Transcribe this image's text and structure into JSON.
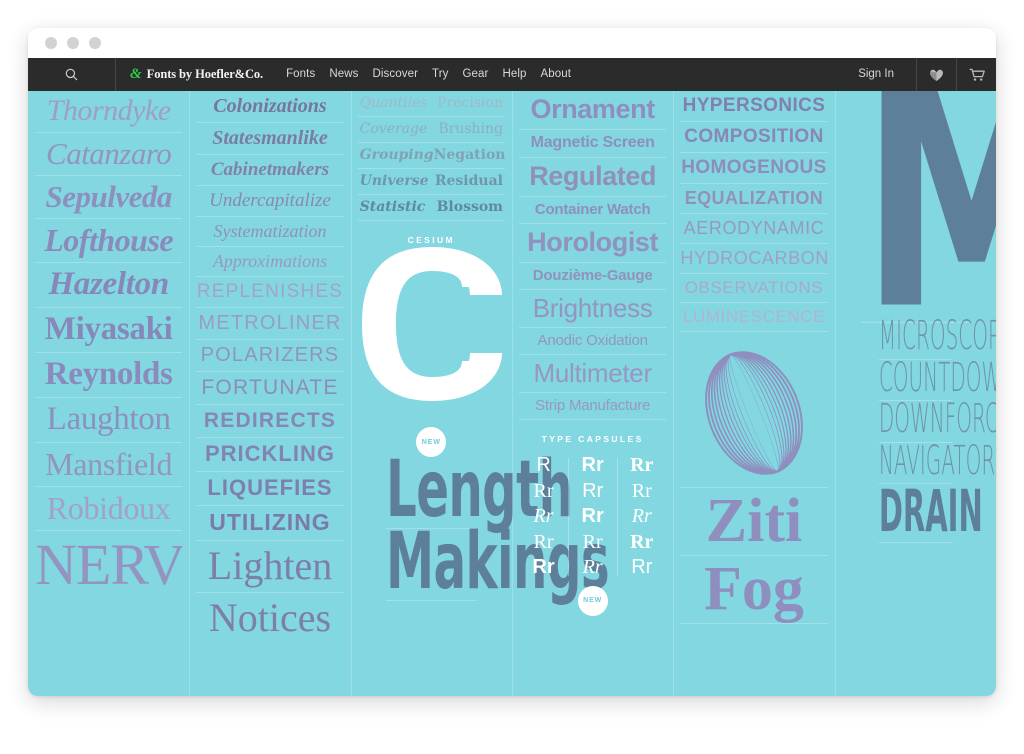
{
  "window": {
    "traffic_lights": [
      "close",
      "minimize",
      "zoom"
    ]
  },
  "nav": {
    "search_icon": "search-icon",
    "brand_ampersand": "&",
    "brand_name": "Fonts by Hoefler&Co.",
    "links": [
      "Fonts",
      "News",
      "Discover",
      "Try",
      "Gear",
      "Help",
      "About"
    ],
    "sign_in": "Sign In",
    "favorites_icon": "heart-icon",
    "cart_icon": "shopping-cart-icon"
  },
  "columns": {
    "col1": {
      "items": [
        {
          "text": "Thorndyke",
          "size": 30,
          "weight": 400,
          "style": "italic",
          "color": "#9f9fc4",
          "tracking": -0.5
        },
        {
          "text": "Catanzaro",
          "size": 31,
          "weight": 400,
          "style": "italic",
          "color": "#9494c0",
          "tracking": -0.5
        },
        {
          "text": "Sepulveda",
          "size": 31,
          "weight": 600,
          "style": "italic",
          "color": "#8e8fbe",
          "tracking": -0.5
        },
        {
          "text": "Lofthouse",
          "size": 32,
          "weight": 700,
          "style": "italic",
          "color": "#8a8bbc",
          "tracking": -0.5
        },
        {
          "text": "Hazelton",
          "size": 33,
          "weight": 700,
          "style": "italic",
          "color": "#8688ba",
          "tracking": -0.3
        },
        {
          "text": "Miyasaki",
          "size": 33,
          "weight": 700,
          "style": "normal",
          "color": "#8688ba",
          "tracking": -0.3
        },
        {
          "text": "Reynolds",
          "size": 33,
          "weight": 700,
          "style": "normal",
          "color": "#8a8bbc",
          "tracking": -0.3
        },
        {
          "text": "Laughton",
          "size": 33,
          "weight": 400,
          "style": "normal",
          "color": "#8e8fbe",
          "tracking": -0.3
        },
        {
          "text": "Mansfield",
          "size": 32,
          "weight": 400,
          "style": "normal",
          "color": "#9494c0",
          "tracking": -0.3
        },
        {
          "text": "Robidoux",
          "size": 32,
          "weight": 400,
          "style": "normal",
          "color": "#a2a2c6",
          "tracking": -0.3
        },
        {
          "text": "NERVE",
          "size": 58,
          "weight": 400,
          "style": "normal",
          "color": "#9494c0",
          "tracking": -1.0
        }
      ]
    },
    "col2": {
      "items": [
        {
          "text": "Colonizations",
          "kind": "serif",
          "size": 20,
          "weight": 700,
          "style": "italic",
          "color": "#76779f"
        },
        {
          "text": "Statesmanlike",
          "kind": "serif",
          "size": 20,
          "weight": 700,
          "style": "italic",
          "color": "#7b7ca4"
        },
        {
          "text": "Cabinetmakers",
          "kind": "serif",
          "size": 19,
          "weight": 600,
          "style": "italic",
          "color": "#8182aa"
        },
        {
          "text": "Undercapitalize",
          "kind": "serif",
          "size": 19,
          "weight": 400,
          "style": "italic",
          "color": "#8889b1"
        },
        {
          "text": "Systematization",
          "kind": "serif",
          "size": 18,
          "weight": 400,
          "style": "italic",
          "color": "#9091b8"
        },
        {
          "text": "Approximations",
          "kind": "serif",
          "size": 18,
          "weight": 400,
          "style": "italic",
          "color": "#9899bf"
        },
        {
          "text": "REPLENISHES",
          "kind": "sans",
          "size": 19,
          "weight": 400,
          "style": "normal",
          "color": "#a3a4c6",
          "tracking": 1.2
        },
        {
          "text": "METROLINER",
          "kind": "sans",
          "size": 20,
          "weight": 400,
          "style": "normal",
          "color": "#9b9cc1",
          "tracking": 1.2
        },
        {
          "text": "POLARIZERS",
          "kind": "sans",
          "size": 20,
          "weight": 500,
          "style": "normal",
          "color": "#9394bd",
          "tracking": 1.2
        },
        {
          "text": "FORTUNATE",
          "kind": "sans",
          "size": 21,
          "weight": 500,
          "style": "normal",
          "color": "#8c8db8",
          "tracking": 1.2
        },
        {
          "text": "REDIRECTS",
          "kind": "sans",
          "size": 21,
          "weight": 600,
          "style": "normal",
          "color": "#8687b4",
          "tracking": 1.2
        },
        {
          "text": "PRICKLING",
          "kind": "sans",
          "size": 22,
          "weight": 700,
          "style": "normal",
          "color": "#8283b1",
          "tracking": 1.0
        },
        {
          "text": "LIQUEFIES",
          "kind": "sans",
          "size": 22,
          "weight": 700,
          "style": "normal",
          "color": "#7e7fae",
          "tracking": 1.0
        },
        {
          "text": "UTILIZING",
          "kind": "sans",
          "size": 23,
          "weight": 800,
          "style": "normal",
          "color": "#7a7bab",
          "tracking": 1.0
        },
        {
          "text": "Lighten",
          "kind": "serif",
          "size": 40,
          "weight": 400,
          "style": "normal",
          "color": "#7d7ea9"
        },
        {
          "text": "Notices",
          "kind": "serif",
          "size": 40,
          "weight": 400,
          "style": "normal",
          "color": "#7d7ea9"
        }
      ]
    },
    "col3": {
      "pairs": [
        {
          "a": "Quantiles",
          "b": "Precision",
          "size": 14,
          "weight": 400,
          "color": "#9fb9c6"
        },
        {
          "a": "Coverage",
          "b": "Brushing",
          "size": 14,
          "weight": 400,
          "color": "#8faebe"
        },
        {
          "a": "Grouping",
          "b": "Negation",
          "size": 14,
          "weight": 600,
          "color": "#7fa3b5"
        },
        {
          "a": "Universe",
          "b": "Residual",
          "size": 14,
          "weight": 700,
          "color": "#6f96ab"
        },
        {
          "a": "Statistic",
          "b": "Blossom",
          "size": 14,
          "weight": 800,
          "color": "#5f89a1"
        }
      ],
      "label": "CESIUM",
      "specimen_letter": "C",
      "badge": "NEW",
      "mega": [
        {
          "text": "Length",
          "size": 78,
          "color": "#5d7f99"
        },
        {
          "text": "Makings",
          "size": 78,
          "color": "#5d7f99"
        }
      ]
    },
    "col4": {
      "items": [
        {
          "text": "Ornament",
          "size": 27,
          "weight": 800,
          "color": "#8e8fbe",
          "tracking": -0.4
        },
        {
          "text": "Magnetic Screen",
          "size": 16,
          "weight": 800,
          "color": "#8e8fbe",
          "tracking": -0.2
        },
        {
          "text": "Regulated",
          "size": 27,
          "weight": 700,
          "color": "#9091bb",
          "tracking": -0.4
        },
        {
          "text": "Container Watch",
          "size": 15,
          "weight": 700,
          "color": "#8e8fbe",
          "tracking": -0.2
        },
        {
          "text": "Horologist",
          "size": 27,
          "weight": 600,
          "color": "#9192bd",
          "tracking": -0.4
        },
        {
          "text": "Douzième-Gauge",
          "size": 15,
          "weight": 600,
          "color": "#9192bd",
          "tracking": -0.2
        },
        {
          "text": "Brightness",
          "size": 26,
          "weight": 500,
          "color": "#9495c0",
          "tracking": -0.3
        },
        {
          "text": "Anodic Oxidation",
          "size": 15,
          "weight": 500,
          "color": "#9495c0",
          "tracking": -0.2
        },
        {
          "text": "Multimeter",
          "size": 26,
          "weight": 400,
          "color": "#9798c2",
          "tracking": -0.3
        },
        {
          "text": "Strip Manufacture",
          "size": 15,
          "weight": 400,
          "color": "#9798c2",
          "tracking": -0.2
        }
      ],
      "label": "TYPE CAPSULES",
      "rr_grid": [
        [
          {
            "text": "R",
            "weight": 400,
            "style": "normal",
            "family": "sans"
          },
          {
            "text": "Rr",
            "weight": 400,
            "style": "normal",
            "family": "serif"
          },
          {
            "text": "Rr",
            "weight": 400,
            "style": "italic",
            "family": "serif"
          },
          {
            "text": "Rr",
            "weight": 400,
            "style": "normal",
            "family": "serif"
          },
          {
            "text": "Rr",
            "weight": 700,
            "style": "normal",
            "family": "sans"
          }
        ],
        [
          {
            "text": "Rr",
            "weight": 700,
            "style": "normal",
            "family": "sans"
          },
          {
            "text": "Rr",
            "weight": 400,
            "style": "normal",
            "family": "sans"
          },
          {
            "text": "Rr",
            "weight": 800,
            "style": "normal",
            "family": "sans"
          },
          {
            "text": "Rr",
            "weight": 400,
            "style": "normal",
            "family": "serif"
          },
          {
            "text": "Rr",
            "weight": 400,
            "style": "italic",
            "family": "serif"
          }
        ],
        [
          {
            "text": "Rr",
            "weight": 700,
            "style": "normal",
            "family": "serif"
          },
          {
            "text": "Rr",
            "weight": 400,
            "style": "normal",
            "family": "serif"
          },
          {
            "text": "Rr",
            "weight": 400,
            "style": "italic",
            "family": "serif"
          },
          {
            "text": "Rr",
            "weight": 800,
            "style": "normal",
            "family": "serif"
          },
          {
            "text": "Rr",
            "weight": 400,
            "style": "normal",
            "family": "sans"
          }
        ]
      ],
      "badge": "NEW"
    },
    "col5": {
      "items": [
        {
          "text": "HYPERSONICS",
          "size": 19,
          "weight": 800,
          "color": "#8081ae",
          "tracking": 0.4
        },
        {
          "text": "COMPOSITION",
          "size": 19,
          "weight": 800,
          "color": "#8788b4",
          "tracking": 0.4
        },
        {
          "text": "HOMOGENOUS",
          "size": 19,
          "weight": 700,
          "color": "#8c8db8",
          "tracking": 0.4
        },
        {
          "text": "EQUALIZATION",
          "size": 18,
          "weight": 700,
          "color": "#9192bc",
          "tracking": 0.4
        },
        {
          "text": "AERODYNAMIC",
          "size": 18,
          "weight": 500,
          "color": "#9899c1",
          "tracking": 0.6
        },
        {
          "text": "HYDROCARBON",
          "size": 18,
          "weight": 400,
          "color": "#9fa0c6",
          "tracking": 0.6
        },
        {
          "text": "OBSERVATIONS",
          "size": 17,
          "weight": 400,
          "color": "#a8a9cc",
          "tracking": 0.6
        },
        {
          "text": "LUMINESCENCE",
          "size": 17,
          "weight": 300,
          "color": "#b2b3d2",
          "tracking": 0.6
        }
      ],
      "specimen_letter": "O",
      "didone": [
        {
          "text": "Ziti",
          "size": 62,
          "color": "#8e8fbe"
        },
        {
          "text": "Fog",
          "size": 62,
          "color": "#8e8fbe"
        }
      ]
    },
    "col6": {
      "specimen_letter": "M",
      "condensed": [
        {
          "text": "MICROSCOPIC",
          "size": 40,
          "weight": 300,
          "color": "#6f93a8"
        },
        {
          "text": "COUNTDOWN",
          "size": 40,
          "weight": 300,
          "color": "#6f93a8"
        },
        {
          "text": "DOWNFORCE",
          "size": 40,
          "weight": 300,
          "color": "#6f93a8"
        },
        {
          "text": "NAVIGATOR",
          "size": 40,
          "weight": 300,
          "color": "#6f93a8"
        },
        {
          "text": "DRAIN",
          "size": 58,
          "weight": 800,
          "color": "#5d7f99"
        }
      ]
    }
  },
  "colors": {
    "page_background": "#82d7e1",
    "nav_background": "#2b2b2b",
    "brand_green": "#2ecc4a",
    "lilac": "#8e8fbe",
    "slate": "#5d7f99",
    "white": "#ffffff"
  }
}
